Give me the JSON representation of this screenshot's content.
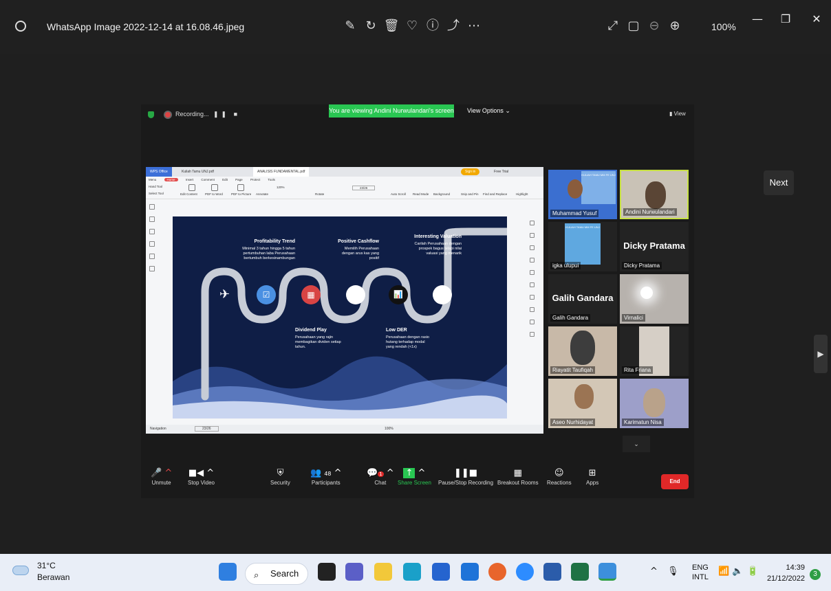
{
  "titlebar": {
    "title": "WhatsApp Image 2022-12-14 at 16.08.46.jpeg",
    "zoom": "100%"
  },
  "viewer": {
    "next_label": "Next"
  },
  "zoom_top": {
    "recording_label": "Recording...",
    "viewing_text": "You are viewing Andini Nurwulandari's screen",
    "view_options": "View Options",
    "view": "View"
  },
  "wps": {
    "tabs": [
      "WPS Office",
      "Kuliah Tamu UNJ.pdf",
      "ANALISIS FUNDAMENTAL.pdf",
      "Sign in",
      "Free Trial"
    ],
    "menu": [
      "Menu",
      "Home",
      "Insert",
      "Comment",
      "Edit",
      "Page",
      "Protect",
      "Tools"
    ],
    "tools": [
      "Hand Tool",
      "Select Tool",
      "Edit Content",
      "PDF to Word",
      "PDF to Picture",
      "Annotate",
      "120%",
      "Rotate",
      "23/26",
      "Auto Scroll",
      "Read Mode",
      "Background",
      "Snip and Pin",
      "Find and Replace",
      "Highlight"
    ],
    "bottom": [
      "Navigation",
      "23/26",
      "100%"
    ]
  },
  "slide": {
    "items": [
      {
        "title": "Profitability Trend",
        "text": "Minimal 3 tahun hingga 5 tahun pertumbuhan laba Perusahaan bertumbuh berkesinambungan"
      },
      {
        "title": "Positive Cashflow",
        "text": "Memilih Perusahaan dengan arus kas yang positif"
      },
      {
        "title": "Interesting Valuation",
        "text": "Carilah Perusahaan dengan prospek bagus tetapi nilai valuasi yang menarik"
      },
      {
        "title": "Dividend Play",
        "text": "Perusahaan yang rajin membagikan dividen setiap tahun."
      },
      {
        "title": "Low DER",
        "text": "Perusahaan dengan rasio hutang terhadap modal yang rendah (<1x)"
      }
    ]
  },
  "participants": [
    {
      "name": "Muhammad Yusuf",
      "big": "",
      "poster": "KULIAH TAMU MM FE UNJ"
    },
    {
      "name": "Andini Nurwulandari",
      "big": "",
      "poster": ""
    },
    {
      "name": "igka ulupui",
      "big": "",
      "poster": "KULIAH TAMU MM FE UNJ"
    },
    {
      "name": "Dicky Pratama",
      "big": "Dicky Pratama",
      "poster": ""
    },
    {
      "name": "Galih Gandara",
      "big": "Galih Gandara",
      "poster": ""
    },
    {
      "name": "Virnalici",
      "big": "",
      "poster": ""
    },
    {
      "name": "Riayatit Taufiqah",
      "big": "",
      "poster": ""
    },
    {
      "name": "Rita Friana",
      "big": "",
      "poster": ""
    },
    {
      "name": "Aseo Nurhidayat",
      "big": "",
      "poster": ""
    },
    {
      "name": "Karimatun Nisa",
      "big": "",
      "poster": ""
    }
  ],
  "zoom_bar": {
    "items": [
      "Unmute",
      "Stop Video",
      "Security",
      "Participants",
      "Chat",
      "Share Screen",
      "Pause/Stop Recording",
      "Breakout Rooms",
      "Reactions",
      "Apps"
    ],
    "participants_count": "48",
    "chat_badge": "1",
    "end_label": "End"
  },
  "taskbar": {
    "temp": "31°C",
    "weather": "Berawan",
    "search": "Search",
    "lang1": "ENG",
    "lang2": "INTL",
    "time": "14:39",
    "date": "21/12/2022",
    "notifications": "3"
  }
}
